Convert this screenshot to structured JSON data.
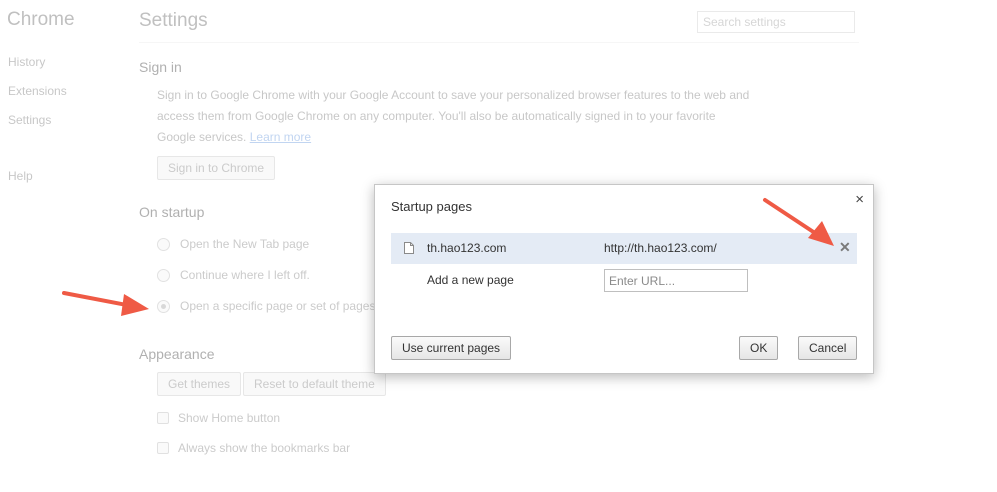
{
  "sidebar": {
    "brand": "Chrome",
    "items": [
      {
        "label": "History"
      },
      {
        "label": "Extensions"
      },
      {
        "label": "Settings"
      },
      {
        "label": "Help"
      }
    ]
  },
  "header": {
    "title": "Settings",
    "search_placeholder": "Search settings"
  },
  "signin": {
    "title": "Sign in",
    "line1": "Sign in to Google Chrome with your Google Account to save your personalized browser features to the web and",
    "line2": "access them from Google Chrome on any computer. You'll also be automatically signed in to your favorite",
    "line3": "Google services.",
    "learn_more": "Learn more",
    "button": "Sign in to Chrome"
  },
  "startup": {
    "title": "On startup",
    "options": [
      {
        "label": "Open the New Tab page",
        "selected": false
      },
      {
        "label": "Continue where I left off.",
        "selected": false
      },
      {
        "label": "Open a specific page or set of pages.",
        "selected": true
      }
    ]
  },
  "appearance": {
    "title": "Appearance",
    "get_themes": "Get themes",
    "reset_theme": "Reset to default theme",
    "show_home": "Show Home button",
    "show_bookmarks": "Always show the bookmarks bar"
  },
  "dialog": {
    "title": "Startup pages",
    "close_glyph": "×",
    "pages": [
      {
        "name": "th.hao123.com",
        "url": "http://th.hao123.com/"
      }
    ],
    "remove_glyph": "✕",
    "add_label": "Add a new page",
    "url_placeholder": "Enter URL...",
    "use_current": "Use current pages",
    "ok": "OK",
    "cancel": "Cancel"
  },
  "colors": {
    "arrow": "#ef5a45",
    "selected_row": "#e4ebf5"
  }
}
